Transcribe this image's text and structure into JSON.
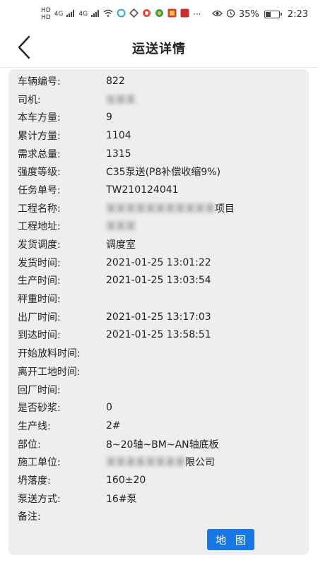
{
  "status_bar": {
    "network_left": "HD",
    "network_left2": "HD",
    "signal1": "4G",
    "signal2": "4G",
    "battery": "35%",
    "time": "2:23",
    "more": "···"
  },
  "header": {
    "title": "运送详情"
  },
  "details": [
    {
      "label": "车辆编号:",
      "value": "822"
    },
    {
      "label": "司机:",
      "value": "张某某"
    },
    {
      "label": "本车方量:",
      "value": "9"
    },
    {
      "label": "累计方量:",
      "value": "1104"
    },
    {
      "label": "需求总量:",
      "value": "1315"
    },
    {
      "label": "强度等级:",
      "value": "C35泵送(P8补偿收缩9%)"
    },
    {
      "label": "任务单号:",
      "value": "TW210124041"
    },
    {
      "label": "工程名称:",
      "value_hidden": "某某某某某某某某某某某",
      "value_tail": "项目"
    },
    {
      "label": "工程地址:",
      "value": "某某某"
    },
    {
      "label": "发货调度:",
      "value": "调度室"
    },
    {
      "label": "发货时间:",
      "value": "2021-01-25 13:01:22"
    },
    {
      "label": "生产时间:",
      "value": "2021-01-25 13:03:54"
    },
    {
      "label": "秤重时间:",
      "value": ""
    },
    {
      "label": "出厂时间:",
      "value": "2021-01-25 13:17:03"
    },
    {
      "label": "到达时间:",
      "value": "2021-01-25 13:58:51"
    },
    {
      "label": "开始放料时间:",
      "value": ""
    },
    {
      "label": "离开工地时间:",
      "value": ""
    },
    {
      "label": "回厂时间:",
      "value": ""
    },
    {
      "label": "是否砂浆:",
      "value": "0"
    },
    {
      "label": "生产线:",
      "value": "2#"
    },
    {
      "label": "部位:",
      "value": "8~20轴~BM~AN轴底板"
    },
    {
      "label": "施工单位:",
      "value_hidden": "某某某某某某某某",
      "value_tail": "限公司"
    },
    {
      "label": "坍落度:",
      "value": "160±20"
    },
    {
      "label": "泵送方式:",
      "value": "16#泵"
    },
    {
      "label": "备注:",
      "value": ""
    }
  ],
  "map_button": {
    "label": "地 图",
    "color": "#1677e5"
  },
  "icons": {
    "back": "chevron-left-icon",
    "wifi": "wifi-icon",
    "eye": "eye-icon",
    "alarm": "alarm-icon",
    "battery": "battery-icon"
  }
}
